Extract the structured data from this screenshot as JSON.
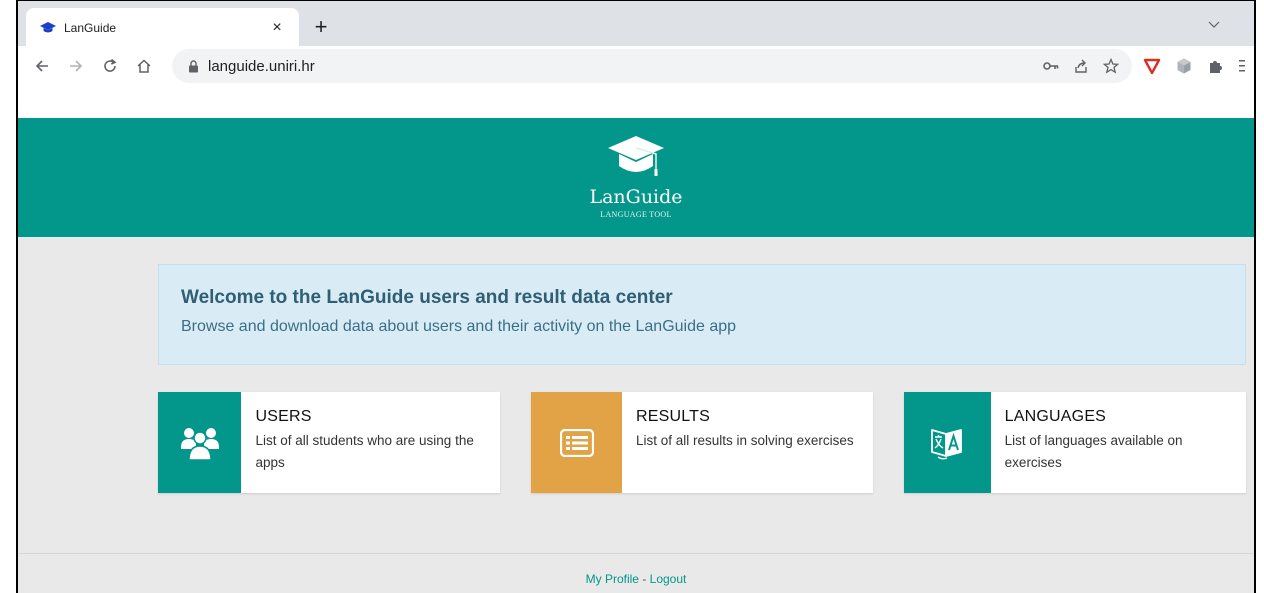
{
  "browser": {
    "tab_title": "LanGuide",
    "close_glyph": "×",
    "new_tab_glyph": "+",
    "url": "languide.uniri.hr"
  },
  "header": {
    "logo_title": "LanGuide",
    "logo_subtitle": "LANGUAGE TOOL"
  },
  "welcome": {
    "title": "Welcome to the LanGuide users and result data center",
    "subtitle": "Browse and download data about users and their activity on the LanGuide app"
  },
  "cards": [
    {
      "title": "USERS",
      "description": "List of all students who are using the apps",
      "icon": "users-icon",
      "color": "#03968a"
    },
    {
      "title": "RESULTS",
      "description": "List of all results in solving exercises",
      "icon": "list-icon",
      "color": "#e1a346"
    },
    {
      "title": "LANGUAGES",
      "description": "List of languages available on exercises",
      "icon": "translate-icon",
      "color": "#03968a"
    }
  ],
  "footer": {
    "profile_label": "My Profile",
    "separator": " - ",
    "logout_label": "Logout"
  },
  "colors": {
    "brand": "#03968a",
    "results_accent": "#e1a346",
    "welcome_bg": "#d9ecf5"
  }
}
